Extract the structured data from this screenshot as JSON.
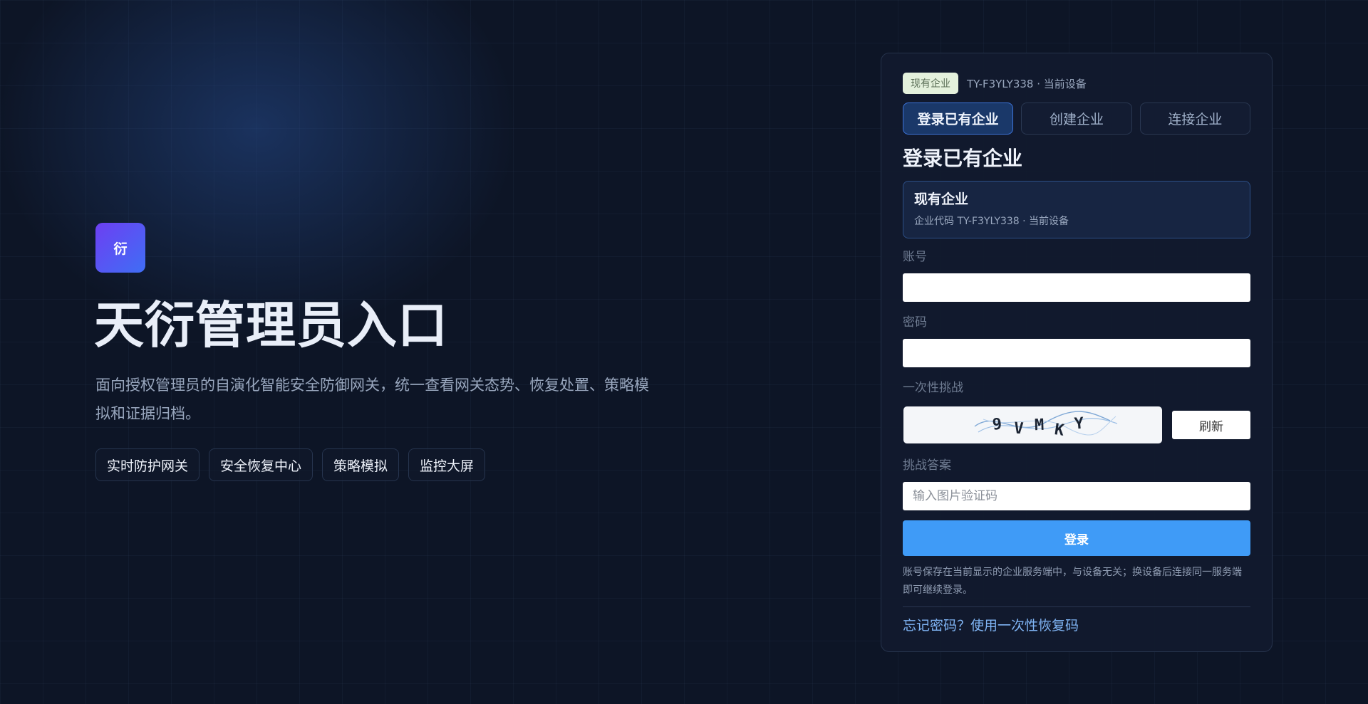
{
  "hero": {
    "logo_char": "衍",
    "title": "天衍管理员入口",
    "description": "面向授权管理员的自演化智能安全防御网关，统一查看网关态势、恢复处置、策略模拟和证据归档。",
    "tags": [
      "实时防护网关",
      "安全恢复中心",
      "策略模拟",
      "监控大屏"
    ]
  },
  "card": {
    "enterprise_badge": "现有企业",
    "enterprise_info": "TY-F3YLY338 · 当前设备",
    "tabs": [
      {
        "label": "登录已有企业",
        "active": true
      },
      {
        "label": "创建企业",
        "active": false
      },
      {
        "label": "连接企业",
        "active": false
      }
    ],
    "form_title": "登录已有企业",
    "enterprise_box": {
      "title": "现有企业",
      "subtitle": "企业代码 TY-F3YLY338 · 当前设备"
    },
    "fields": {
      "account_label": "账号",
      "account_value": "",
      "password_label": "密码",
      "password_value": "",
      "challenge_label": "一次性挑战",
      "captcha_text": [
        "9",
        "V",
        "M",
        "K",
        "Y"
      ],
      "refresh_label": "刷新",
      "answer_label": "挑战答案",
      "answer_placeholder": "输入图片验证码"
    },
    "login_label": "登录",
    "note": "账号保存在当前显示的企业服务端中，与设备无关；换设备后连接同一服务端即可继续登录。",
    "forgot_link": "忘记密码？使用一次性恢复码"
  },
  "colors": {
    "background": "#0d1526",
    "accent": "#3f9bf7",
    "logo_gradient_start": "#6d3ff2",
    "logo_gradient_end": "#3f6ef5",
    "active_tab": "#1a3869",
    "badge_bg": "#e4f1dc"
  },
  "icons": {
    "logo": "logo-icon",
    "captcha": "captcha-image"
  }
}
